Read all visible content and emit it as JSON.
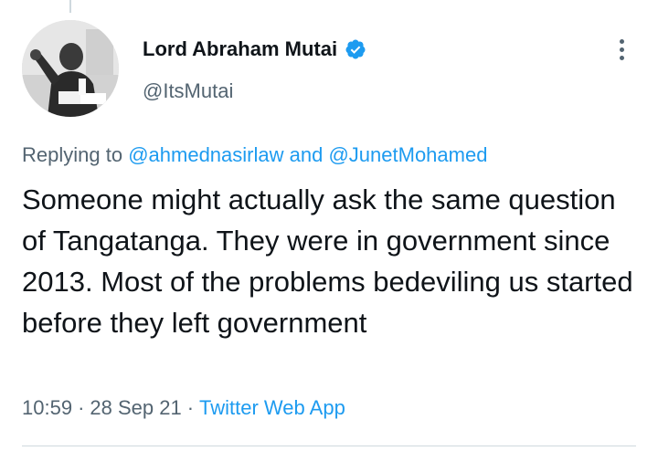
{
  "tweet": {
    "author": {
      "display_name": "Lord Abraham Mutai",
      "handle": "@ItsMutai",
      "verified": true,
      "avatar_icon": "profile-photo"
    },
    "replying_to": {
      "prefix": "Replying to",
      "mention_1": "@ahmednasirlaw",
      "joiner": "and",
      "mention_2": "@JunetMohamed"
    },
    "text": "Someone might actually ask the same question of Tangatanga. They were in government since 2013. Most of the problems bedeviling us started before they left government",
    "meta": {
      "time": "10:59",
      "separator_1": "·",
      "date": "28 Sep 21",
      "separator_2": "·",
      "source": "Twitter Web App"
    }
  },
  "colors": {
    "text": "#0f1419",
    "secondary": "#536471",
    "link": "#1d9bf0",
    "verified": "#1d9bf0",
    "border": "#cfd9de"
  },
  "icons": {
    "verified": "verified-badge-icon",
    "more": "more-options-icon"
  }
}
